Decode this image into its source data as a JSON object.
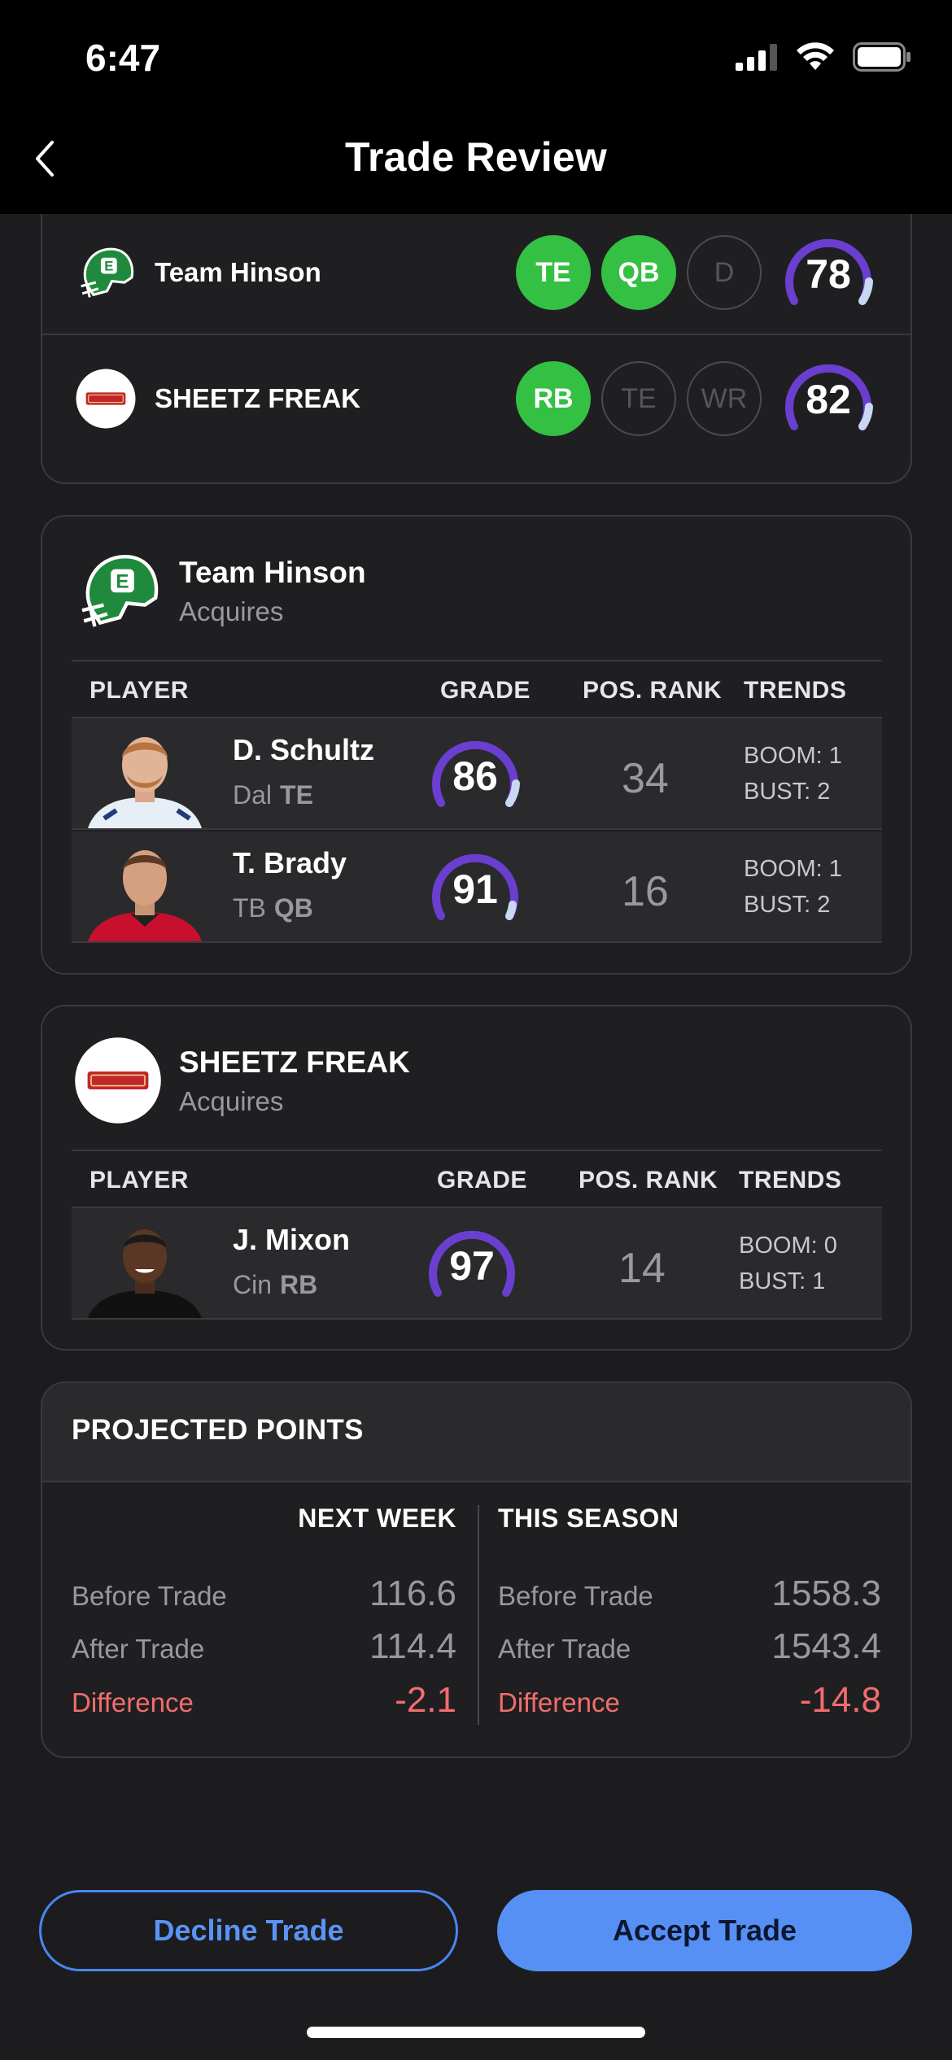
{
  "status": {
    "time": "6:47"
  },
  "nav": {
    "title": "Trade Review"
  },
  "summary": {
    "teams": [
      {
        "name": "Team Hinson",
        "logo": "jets-helmet-icon",
        "positions": [
          {
            "label": "TE",
            "filled": true
          },
          {
            "label": "QB",
            "filled": true
          },
          {
            "label": "D",
            "filled": false
          }
        ],
        "grade": "78"
      },
      {
        "name": "SHEETZ FREAK",
        "logo": "sheetz-logo-icon",
        "positions": [
          {
            "label": "RB",
            "filled": true
          },
          {
            "label": "TE",
            "filled": false
          },
          {
            "label": "WR",
            "filled": false
          }
        ],
        "grade": "82"
      }
    ]
  },
  "team_a": {
    "name": "Team Hinson",
    "subtitle": "Acquires",
    "columns": [
      "PLAYER",
      "GRADE",
      "POS. RANK",
      "TRENDS"
    ],
    "players": [
      {
        "name": "D. Schultz",
        "team": "Dal",
        "pos": "TE",
        "grade": "86",
        "rank": "34",
        "boom": "BOOM: 1",
        "bust": "BUST: 2"
      },
      {
        "name": "T. Brady",
        "team": "TB",
        "pos": "QB",
        "grade": "91",
        "rank": "16",
        "boom": "BOOM: 1",
        "bust": "BUST: 2"
      }
    ]
  },
  "team_b": {
    "name": "SHEETZ FREAK",
    "subtitle": "Acquires",
    "columns": [
      "PLAYER",
      "GRADE",
      "POS. RANK",
      "TRENDS"
    ],
    "players": [
      {
        "name": "J. Mixon",
        "team": "Cin",
        "pos": "RB",
        "grade": "97",
        "rank": "14",
        "boom": "BOOM: 0",
        "bust": "BUST: 1"
      }
    ]
  },
  "projected": {
    "title": "PROJECTED POINTS",
    "next_week": {
      "heading": "NEXT WEEK",
      "before_label": "Before Trade",
      "before": "116.6",
      "after_label": "After Trade",
      "after": "114.4",
      "diff_label": "Difference",
      "diff": "-2.1"
    },
    "this_season": {
      "heading": "THIS SEASON",
      "before_label": "Before Trade",
      "before": "1558.3",
      "after_label": "After Trade",
      "after": "1543.4",
      "diff_label": "Difference",
      "diff": "-14.8"
    }
  },
  "actions": {
    "decline": "Decline Trade",
    "accept": "Accept Trade"
  },
  "colors": {
    "accent": "#5690f5",
    "grade_ring": "#6a3fd0",
    "grade_tail": "#c9d7f5",
    "position_filled": "#34c043",
    "difference": "#f26d6d"
  }
}
